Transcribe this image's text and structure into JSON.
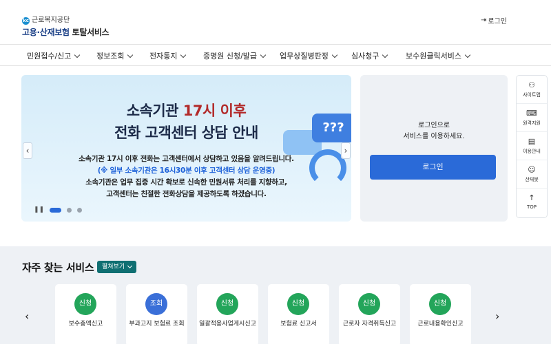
{
  "header": {
    "logo_top": "근로복지공단",
    "logo_mark": "kc",
    "logo_main": "고용·산재보험",
    "logo_sub": "토탈서비스",
    "login_link": "로그인"
  },
  "nav": {
    "items": [
      {
        "label": "민원접수/신고"
      },
      {
        "label": "정보조회"
      },
      {
        "label": "전자통지"
      },
      {
        "label": "증명원 신청/발급"
      },
      {
        "label": "업무상질병판정"
      },
      {
        "label": "심사청구"
      },
      {
        "label": "보수원클릭서비스"
      }
    ]
  },
  "banner": {
    "title_line1_a": "소속기관",
    "title_line1_b": "17시 이후",
    "title_line2": "전화 고객센터 상담 안내",
    "line1": "소속기관 17시 이후 전화는 고객센터에서 상담하고 있음을 알려드립니다.",
    "line2": "(※ 일부 소속기관은 16시30분 이후 고객센터 상담 운영중)",
    "line3": "소속기관은 업무 집중 시간 확보로 신속한 민원서류 처리를 지향하고,",
    "line4": "고객센터는 친절한 전화상담을 제공하도록 하겠습니다.",
    "bubble_text": "???",
    "prev_icon": "‹",
    "next_icon": "›",
    "pause_icon": "❚❚",
    "active_slide": 1,
    "slide_count": 3
  },
  "login_panel": {
    "msg_line1": "로그인으로",
    "msg_line2": "서비스를 이용하세요.",
    "button": "로그인"
  },
  "quick_menu": [
    {
      "icon": "sitemap-icon",
      "glyph": "⚇",
      "label": "사이트맵"
    },
    {
      "icon": "remote-support-icon",
      "glyph": "⌨",
      "label": "원격지원"
    },
    {
      "icon": "guide-icon",
      "glyph": "▤",
      "label": "이용안내"
    },
    {
      "icon": "chatbot-icon",
      "glyph": "☺",
      "label": "산재봇"
    },
    {
      "icon": "arrow-up-icon",
      "glyph": "↑",
      "label": "TOP"
    }
  ],
  "services": {
    "title": "자주 찾는 서비스",
    "toggle": "펼쳐보기",
    "prev_icon": "‹",
    "next_icon": "›",
    "cards": [
      {
        "badge": "신청",
        "label": "보수총액신고",
        "color": "green"
      },
      {
        "badge": "조회",
        "label": "부과고지 보험료 조회",
        "color": "blue"
      },
      {
        "badge": "신청",
        "label": "일괄적용사업게시신고",
        "color": "green"
      },
      {
        "badge": "신청",
        "label": "보험료 신고서",
        "color": "green"
      },
      {
        "badge": "신청",
        "label": "근로자 자격취득신고",
        "color": "green"
      },
      {
        "badge": "신청",
        "label": "근로내용확인신고",
        "color": "green"
      }
    ]
  },
  "colors": {
    "primary": "#2a6ad8",
    "accent_green": "#23a55a",
    "toggle_teal": "#0f6f72",
    "highlight_red": "#b22a2a"
  }
}
